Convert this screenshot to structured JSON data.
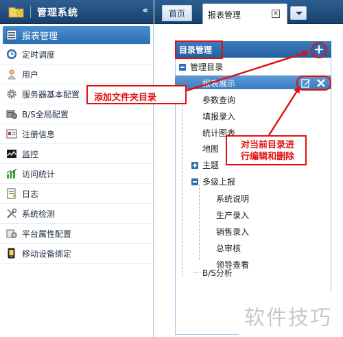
{
  "sidebar": {
    "title": "管理系统",
    "collapse_glyph": "«",
    "items": [
      {
        "label": "报表管理",
        "icon": "report-icon",
        "active": true
      },
      {
        "label": "定时调度",
        "icon": "clock-icon"
      },
      {
        "label": "用户",
        "icon": "user-icon"
      },
      {
        "label": "服务器基本配置",
        "icon": "gear-icon"
      },
      {
        "label": "B/S全局配置",
        "icon": "database-icon"
      },
      {
        "label": "注册信息",
        "icon": "register-icon"
      },
      {
        "label": "监控",
        "icon": "monitor-icon"
      },
      {
        "label": "访问统计",
        "icon": "chart-icon"
      },
      {
        "label": "日志",
        "icon": "log-icon"
      },
      {
        "label": "系统检测",
        "icon": "tools-icon"
      },
      {
        "label": "平台属性配置",
        "icon": "platform-icon"
      },
      {
        "label": "移动设备绑定",
        "icon": "mobile-icon"
      }
    ]
  },
  "tabs": {
    "home": "首页",
    "report": "报表管理",
    "close_glyph": "×"
  },
  "directory": {
    "header": "目录管理",
    "add_glyph": "+",
    "root": "管理目录",
    "selected": "报表展示",
    "children": [
      "参数查询",
      "填报录入",
      "统计图表",
      "地图"
    ],
    "collapsed_group": "主题",
    "group2": "多级上报",
    "group2_children": [
      "系统说明",
      "生产录入",
      "销售录入",
      "总审核",
      "领导查看"
    ],
    "last": "B/S分析"
  },
  "callouts": {
    "add_folder": "添加文件夹目录",
    "edit_delete_line1": "对当前目录进",
    "edit_delete_line2": "行编辑和删除"
  },
  "watermark": "软件技巧",
  "colors": {
    "header_dark": "#173f6b",
    "accent_blue": "#2a6fb4",
    "callout_red": "#e01010"
  }
}
